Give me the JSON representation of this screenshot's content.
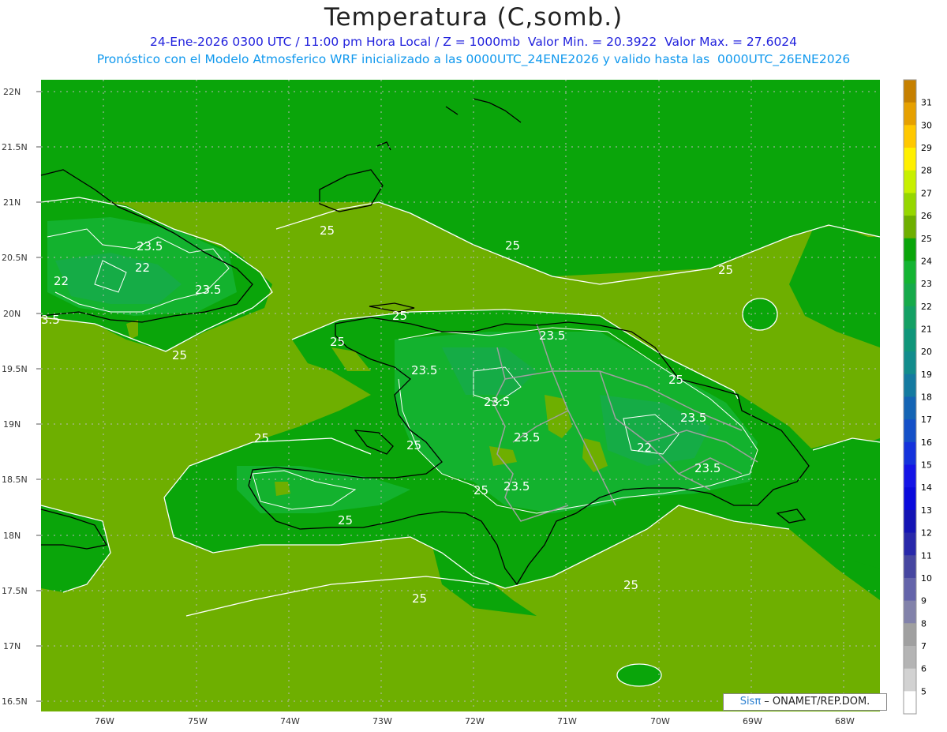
{
  "header": {
    "title": "Temperatura (C,somb.)",
    "line1": "24-Ene-2026 0300 UTC / 11:00 pm Hora Local / Z = 1000mb  Valor Min. = 20.3922  Valor Max. = 27.6024",
    "line2": "Pronóstico con el Modelo Atmosferico WRF inicializado a las 0000UTC_24ENE2026 y valido hasta las  0000UTC_26ENE2026"
  },
  "axes": {
    "lat_labels": [
      "22N",
      "21.5N",
      "21N",
      "20.5N",
      "20N",
      "19.5N",
      "19N",
      "18.5N",
      "18N",
      "17.5N",
      "17N",
      "16.5N"
    ],
    "lon_labels": [
      "76W",
      "75W",
      "74W",
      "73W",
      "72W",
      "71W",
      "70W",
      "69W",
      "68W"
    ]
  },
  "colorbar": {
    "labels": [
      "31",
      "30",
      "29",
      "28",
      "27",
      "26",
      "25",
      "24",
      "23",
      "22",
      "21",
      "20",
      "19",
      "18",
      "17",
      "16",
      "15",
      "14",
      "13",
      "12",
      "11",
      "10",
      "9",
      "8",
      "7",
      "6",
      "5"
    ],
    "colors": [
      "#c68000",
      "#e6a000",
      "#ffc800",
      "#fff000",
      "#c8f000",
      "#96d700",
      "#6eaf00",
      "#0aa50a",
      "#14b432",
      "#16aa4a",
      "#14a064",
      "#10967a",
      "#128c8c",
      "#147aa0",
      "#1464b4",
      "#1450c8",
      "#1432dc",
      "#1414e6",
      "#0a0adc",
      "#1414b4",
      "#2828aa",
      "#4646a0",
      "#6464aa",
      "#8282aa",
      "#a0a0a0",
      "#b4b4b4",
      "#d2d2d2",
      "#ffffff"
    ]
  },
  "contour_labels": [
    "25",
    "25",
    "25",
    "25",
    "25",
    "25",
    "25",
    "25",
    "25",
    "25",
    "25",
    "25",
    "25",
    "23.5",
    "23.5",
    "23.5",
    "23.5",
    "23.5",
    "23.5",
    "23.5",
    "23.5",
    "23.5",
    "22",
    "22",
    "22",
    "3.5"
  ],
  "credit": {
    "sis": "Sis",
    "pi": "π",
    "text": " – ONAMET/REP.DOM."
  },
  "colors": {
    "ocean_field": "#6eaf00",
    "land_field": "#0aa50a",
    "title_blue": "#2222dd",
    "subtitle_cyan": "#1199ee"
  }
}
